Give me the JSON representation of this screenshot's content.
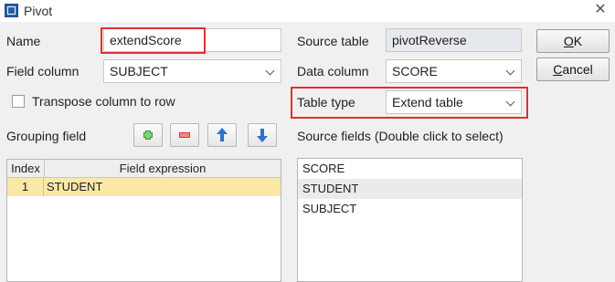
{
  "window": {
    "title": "Pivot",
    "icon": "app-table-icon"
  },
  "form": {
    "name_label": "Name",
    "name_value": "extendScore",
    "field_column_label": "Field column",
    "field_column_value": "SUBJECT",
    "source_table_label": "Source table",
    "source_table_value": "pivotReverse",
    "data_column_label": "Data column",
    "data_column_value": "SCORE",
    "transpose_label": "Transpose column to row",
    "transpose_checked": false,
    "table_type_label": "Table type",
    "table_type_value": "Extend table",
    "grouping_field_label": "Grouping field",
    "source_fields_label": "Source fields (Double click to select)"
  },
  "buttons": {
    "ok": "OK",
    "ok_mnemonic": "O",
    "ok_rest": "K",
    "cancel": "Cancel",
    "cancel_mnemonic": "C",
    "cancel_rest": "ancel"
  },
  "toolbar": {
    "add_icon": "plus-icon",
    "remove_icon": "minus-icon",
    "up_icon": "arrow-up-icon",
    "down_icon": "arrow-down-icon"
  },
  "grouping_table": {
    "columns": [
      "Index",
      "Field expression"
    ],
    "rows": [
      {
        "index": "1",
        "expression": "STUDENT"
      }
    ]
  },
  "source_fields": [
    "SCORE",
    "STUDENT",
    "SUBJECT"
  ],
  "colors": {
    "highlight_red": "#e03030",
    "selected_row": "#fbe8a6",
    "hover_row": "#ebebeb",
    "icon_green": "#2e9e2e",
    "icon_red": "#d43a3a",
    "icon_blue": "#2f6fd0"
  }
}
